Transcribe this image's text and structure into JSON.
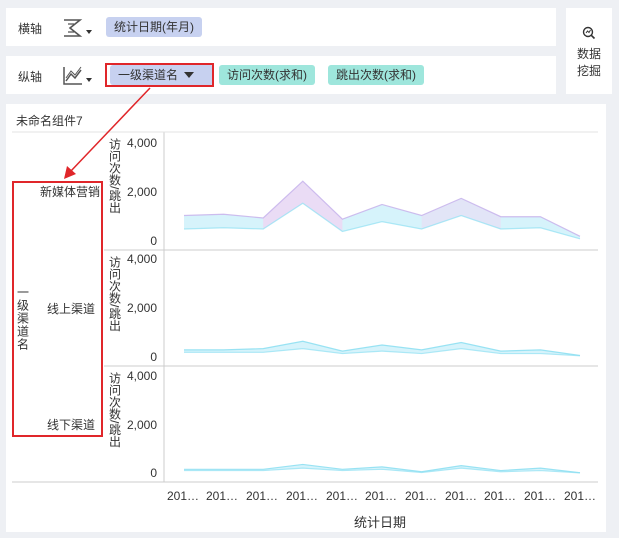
{
  "toolbar": {
    "x_axis_label": "横轴",
    "y_axis_label": "纵轴",
    "x_axis_icon": "chart-type-icon",
    "y_axis_icon": "line-chart-icon",
    "x_fields": [
      "统计日期(年月)"
    ],
    "y_fields": {
      "dimension": "一级渠道名",
      "measures": [
        "访问次数(求和)",
        "跳出次数(求和)"
      ]
    },
    "mining_icon": "data-mining-icon",
    "mining_label_1": "数据",
    "mining_label_2": "挖掘"
  },
  "panel": {
    "title": "未命名组件7"
  },
  "colors": {
    "pill_blue": "#c7d1f0",
    "pill_teal": "#9ee6dc",
    "area_fill": "#d6f3fb",
    "line_color": "#8fe0f2",
    "highlight_fill": "#eadcf5",
    "highlight_line": "#c9b6ec",
    "annotation": "#e0262a"
  },
  "chart_data": {
    "type": "area",
    "facet_title": "一级渠道名",
    "y_axis_title": "访问次数/跳出",
    "x_axis_title": "统计日期",
    "x": [
      "201…",
      "201…",
      "201…",
      "201…",
      "201…",
      "201…",
      "201…",
      "201…",
      "201…",
      "201…",
      "201…"
    ],
    "y_ticks": [
      "4,000",
      "2,000",
      "0"
    ],
    "ylim": [
      0,
      4000
    ],
    "facets": [
      {
        "name": "新媒体营销",
        "series": [
          {
            "values": [
              1000,
              1050,
              900,
              2400,
              850,
              1450,
              1000,
              1700,
              950,
              950,
              150
            ]
          },
          {
            "values": [
              450,
              500,
              450,
              1500,
              350,
              750,
              450,
              1000,
              450,
              500,
              50
            ]
          }
        ]
      },
      {
        "name": "线上渠道",
        "series": [
          {
            "values": [
              250,
              250,
              300,
              600,
              200,
              450,
              250,
              550,
              200,
              250,
              20
            ]
          },
          {
            "values": [
              150,
              150,
              150,
              300,
              100,
              200,
              100,
              300,
              100,
              100,
              10
            ]
          }
        ]
      },
      {
        "name": "线下渠道",
        "series": [
          {
            "values": [
              150,
              150,
              150,
              350,
              150,
              250,
              50,
              300,
              100,
              200,
              10
            ]
          },
          {
            "values": [
              100,
              100,
              100,
              200,
              100,
              150,
              20,
              200,
              50,
              100,
              5
            ]
          }
        ]
      }
    ]
  }
}
